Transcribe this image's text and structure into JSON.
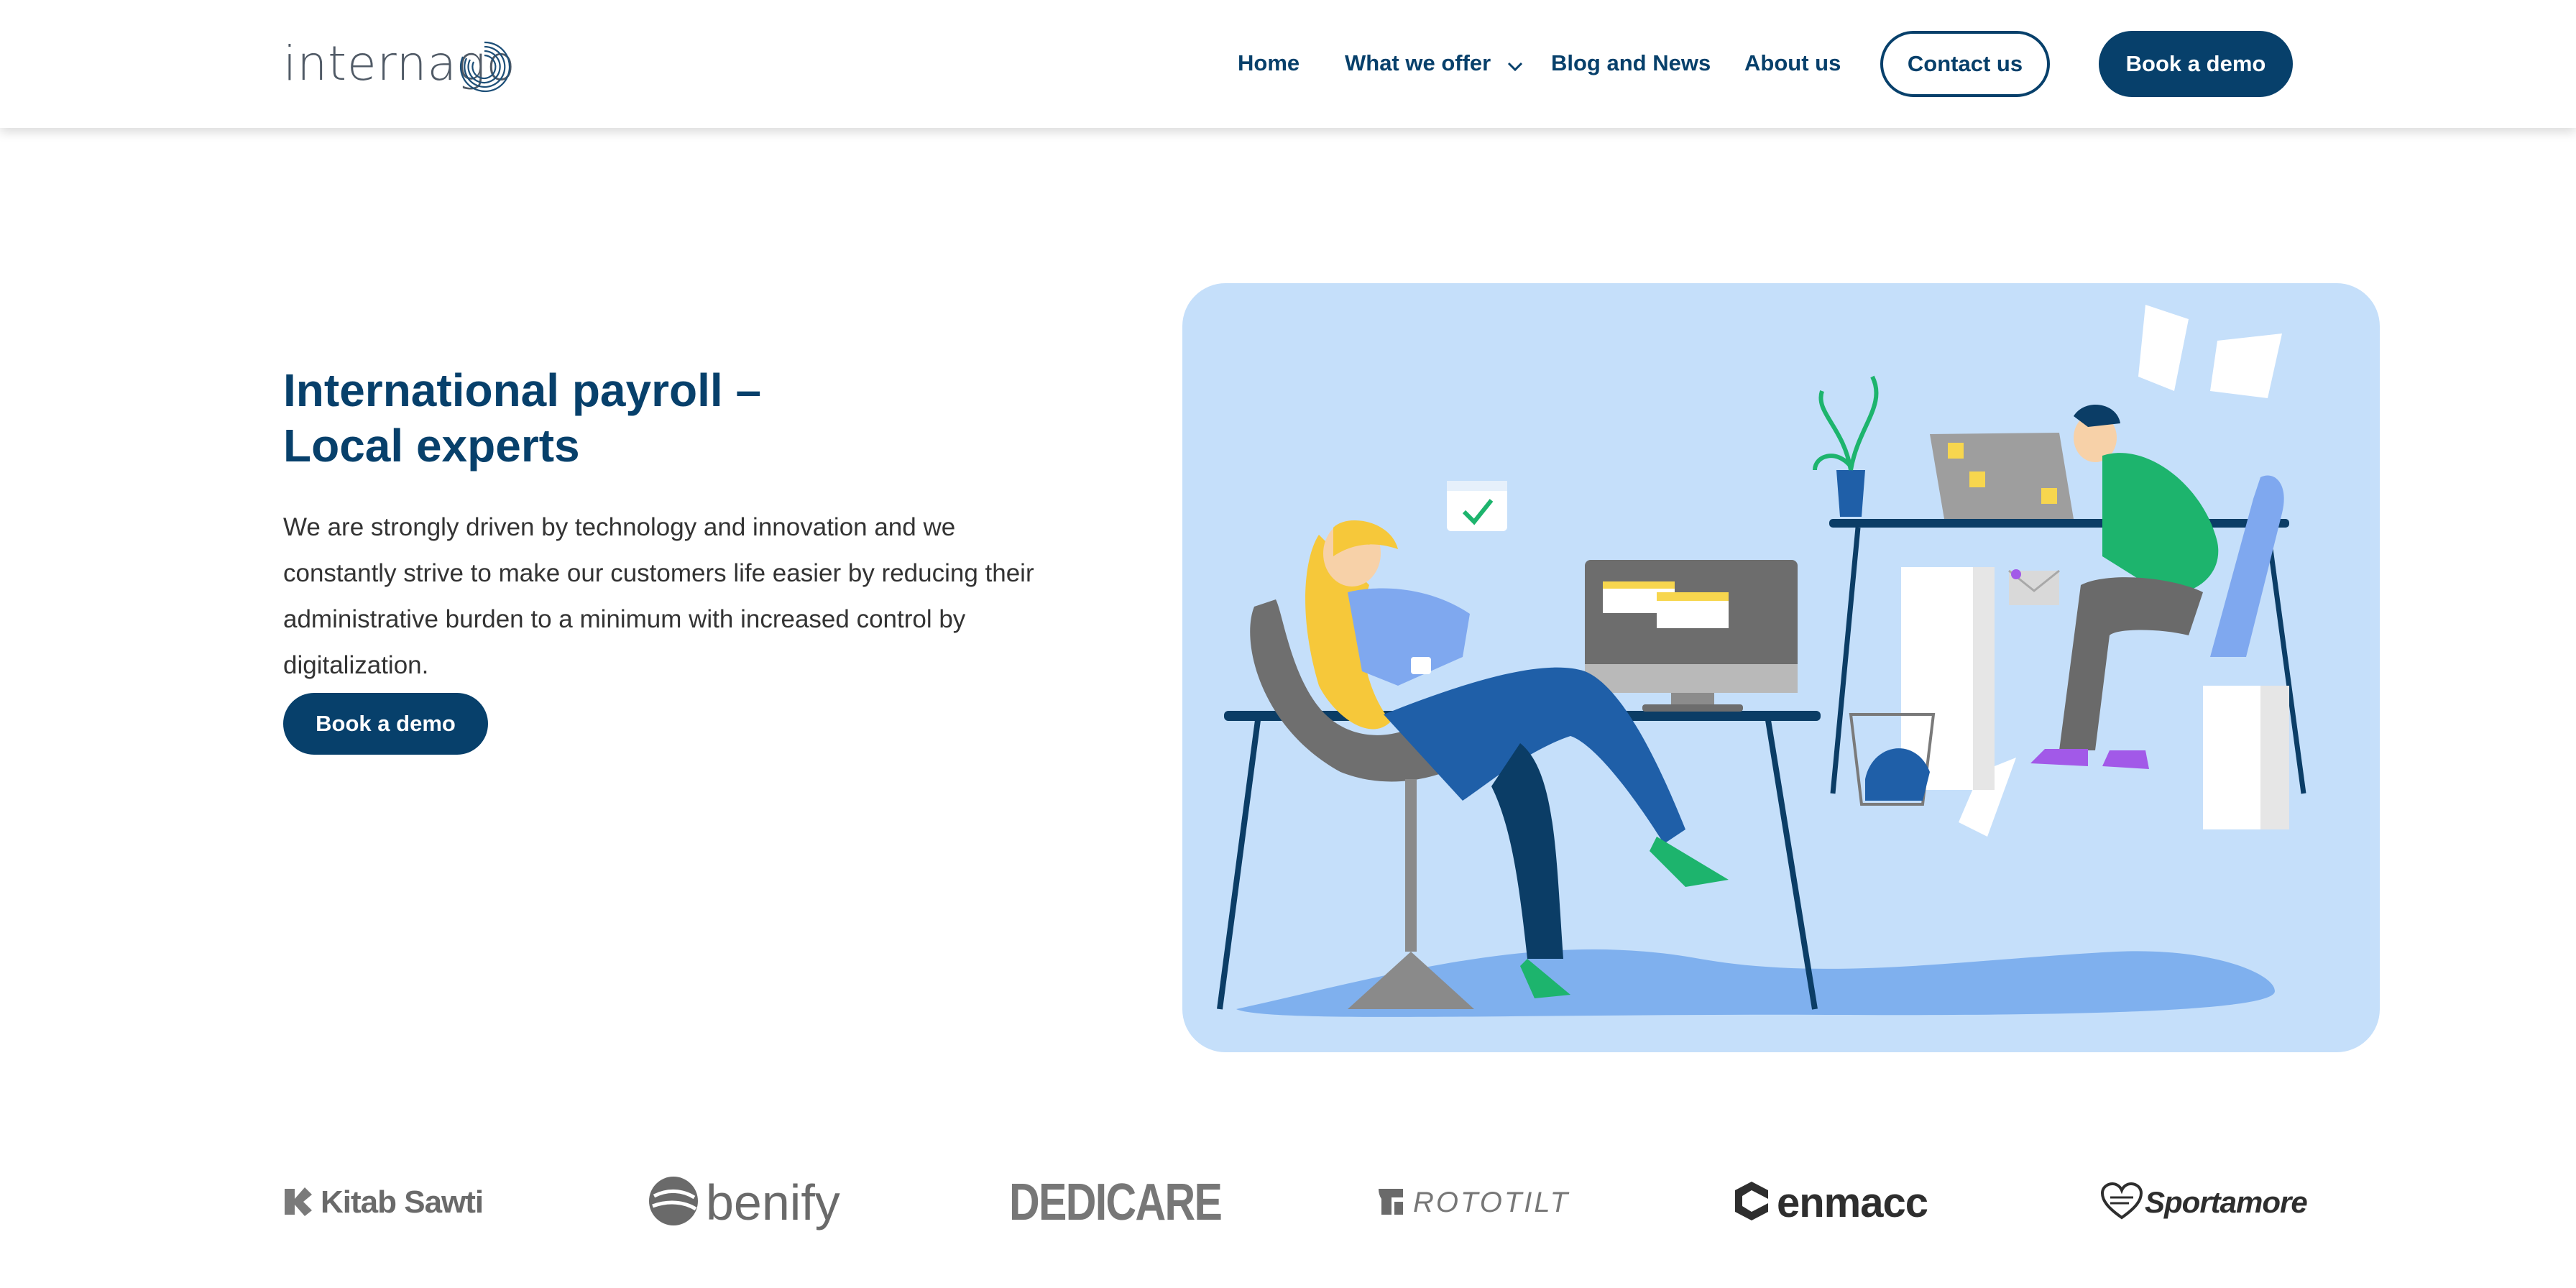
{
  "header": {
    "logo_text": "internago",
    "nav": [
      {
        "label": "Home"
      },
      {
        "label": "What we offer"
      },
      {
        "label": "Blog and News"
      },
      {
        "label": "About us"
      }
    ],
    "contact_label": "Contact us",
    "demo_label": "Book a demo"
  },
  "hero": {
    "title_line1": "International payroll –",
    "title_line2": "Local experts",
    "description": "We are strongly driven by technology and innovation and we constantly strive to make our customers life easier by reducing their administrative burden to a minimum with increased control by digitalization.",
    "cta_label": "Book a demo"
  },
  "clients": [
    {
      "name": "Kitab Sawti",
      "icon": "kitab-sawti-icon"
    },
    {
      "name": "benify",
      "icon": "benify-icon"
    },
    {
      "name": "DEDICARE",
      "icon": "none"
    },
    {
      "name": "ROTOTILT",
      "icon": "rototilt-icon"
    },
    {
      "name": "enmacc",
      "icon": "enmacc-icon"
    },
    {
      "name": "Sportamore",
      "icon": "sportamore-heart-icon"
    }
  ],
  "colors": {
    "brand_navy": "#07406b",
    "illustration_bg": "#c5dffa",
    "logo_gray": "#505a66"
  }
}
